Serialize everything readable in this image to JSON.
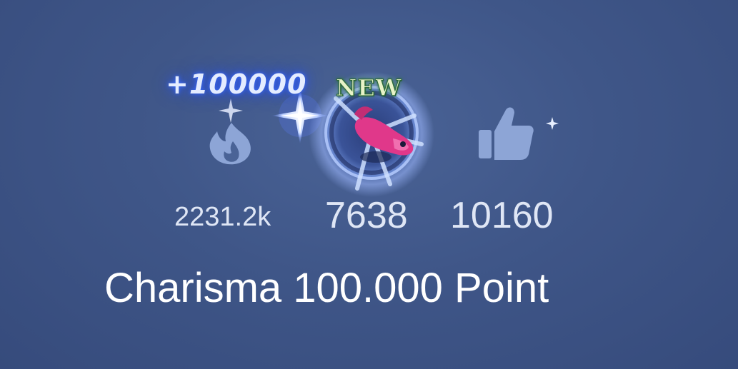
{
  "stats": {
    "popularity": {
      "icon": "flame-icon",
      "value": "2231.2k"
    },
    "charisma": {
      "icon": "charisma-emblem-icon",
      "value": "7638",
      "badge": "NEW",
      "gain": "+100000"
    },
    "likes": {
      "icon": "thumbs-up-icon",
      "value": "10160"
    }
  },
  "caption": "Charisma 100.000 Point",
  "colors": {
    "background": "#3f5688",
    "icon": "#8da5d6",
    "value_text": "#dfe6f5",
    "glow": "#3a6bff",
    "badge_text": "#e8f3c8",
    "badge_outline": "#2c6b3a",
    "emblem_pink": "#e0388a"
  }
}
